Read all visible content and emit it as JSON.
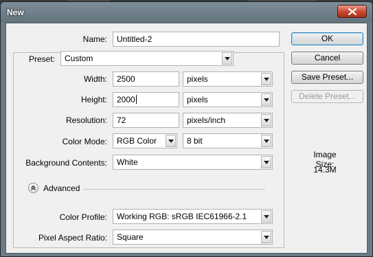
{
  "window": {
    "title": "New"
  },
  "form": {
    "name_label": "Name:",
    "name_value": "Untitled-2",
    "preset_label": "Preset:",
    "preset_value": "Custom",
    "width_label": "Width:",
    "width_value": "2500",
    "width_unit": "pixels",
    "height_label": "Height:",
    "height_value": "2000",
    "height_unit": "pixels",
    "resolution_label": "Resolution:",
    "resolution_value": "72",
    "resolution_unit": "pixels/inch",
    "color_mode_label": "Color Mode:",
    "color_mode_value": "RGB Color",
    "bit_depth_value": "8 bit",
    "background_label": "Background Contents:",
    "background_value": "White",
    "advanced_label": "Advanced",
    "color_profile_label": "Color Profile:",
    "color_profile_value": "Working RGB:  sRGB IEC61966-2.1",
    "pixel_aspect_label": "Pixel Aspect Ratio:",
    "pixel_aspect_value": "Square"
  },
  "buttons": {
    "ok": "OK",
    "cancel": "Cancel",
    "save_preset": "Save Preset...",
    "delete_preset": "Delete Preset..."
  },
  "info": {
    "image_size_label": "Image Size:",
    "image_size_value": "14.3M"
  },
  "icons": {
    "close": "close-icon",
    "advanced": "chevron-up-icon",
    "dropdown": "chevron-down-icon"
  },
  "colors": {
    "close_button": "#c8472f",
    "default_button_border": "#3c7fb1",
    "titlebar": "#6b7b86"
  }
}
